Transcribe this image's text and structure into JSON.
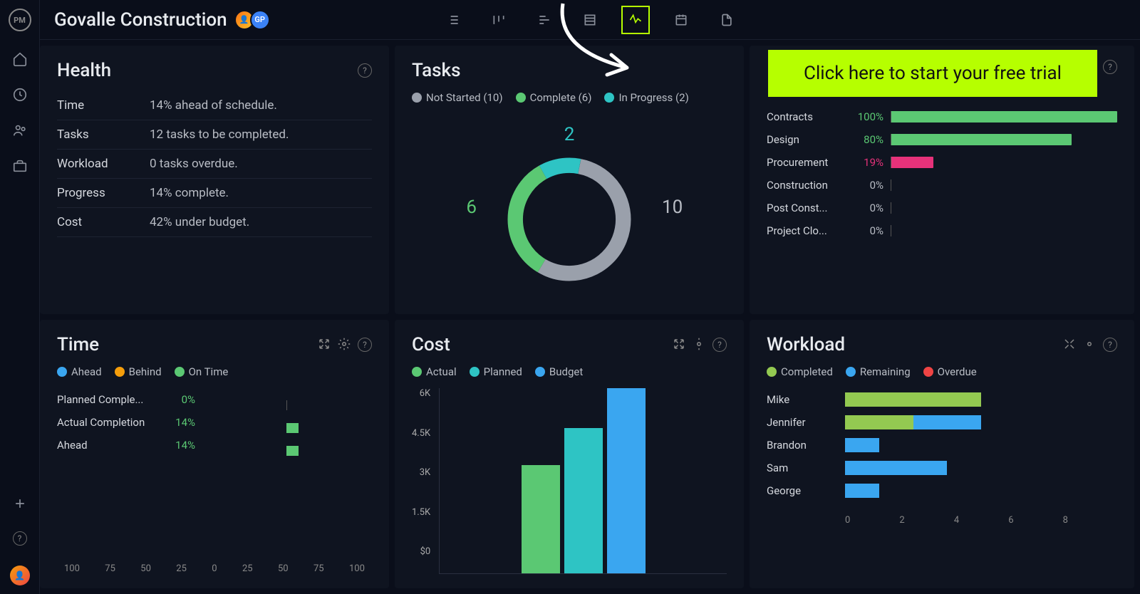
{
  "project_title": "Govalle Construction",
  "avatar_initials": "GP",
  "cta_text": "Click here to start your free trial",
  "colors": {
    "green": "#5bc873",
    "teal": "#2ec4c4",
    "gray": "#9aa0ab",
    "blue": "#3aa6f0",
    "pink": "#e6327a",
    "lime": "#93c951",
    "orange": "#f59e0b",
    "red": "#ef4444"
  },
  "health": {
    "title": "Health",
    "rows": [
      {
        "label": "Time",
        "value": "14% ahead of schedule."
      },
      {
        "label": "Tasks",
        "value": "12 tasks to be completed."
      },
      {
        "label": "Workload",
        "value": "0 tasks overdue."
      },
      {
        "label": "Progress",
        "value": "14% complete."
      },
      {
        "label": "Cost",
        "value": "42% under budget."
      }
    ]
  },
  "tasks": {
    "title": "Tasks",
    "legend": [
      {
        "label": "Not Started (10)",
        "color": "#9aa0ab"
      },
      {
        "label": "Complete (6)",
        "color": "#5bc873"
      },
      {
        "label": "In Progress (2)",
        "color": "#2ec4c4"
      }
    ],
    "top_label": "2",
    "left_label": "6",
    "right_label": "10"
  },
  "progress": {
    "rows": [
      {
        "name": "Contracts",
        "pct": 100,
        "color": "#5bc873"
      },
      {
        "name": "Design",
        "pct": 80,
        "color": "#5bc873"
      },
      {
        "name": "Procurement",
        "pct": 19,
        "color": "#e6327a"
      },
      {
        "name": "Construction",
        "pct": 0,
        "color": "#5bc873"
      },
      {
        "name": "Post Const...",
        "pct": 0,
        "color": "#5bc873"
      },
      {
        "name": "Project Clo...",
        "pct": 0,
        "color": "#5bc873"
      }
    ]
  },
  "time": {
    "title": "Time",
    "legend": [
      {
        "label": "Ahead",
        "color": "#3aa6f0"
      },
      {
        "label": "Behind",
        "color": "#f59e0b"
      },
      {
        "label": "On Time",
        "color": "#5bc873"
      }
    ],
    "rows": [
      {
        "name": "Planned Comple...",
        "pct": 0
      },
      {
        "name": "Actual Completion",
        "pct": 14
      },
      {
        "name": "Ahead",
        "pct": 14
      }
    ],
    "axis": [
      "100",
      "75",
      "50",
      "25",
      "0",
      "25",
      "50",
      "75",
      "100"
    ]
  },
  "cost": {
    "title": "Cost",
    "legend": [
      {
        "label": "Actual",
        "color": "#5bc873"
      },
      {
        "label": "Planned",
        "color": "#2ec4c4"
      },
      {
        "label": "Budget",
        "color": "#3aa6f0"
      }
    ],
    "yaxis": [
      "6K",
      "4.5K",
      "3K",
      "1.5K",
      "$0"
    ]
  },
  "workload": {
    "title": "Workload",
    "legend": [
      {
        "label": "Completed",
        "color": "#93c951"
      },
      {
        "label": "Remaining",
        "color": "#3aa6f0"
      },
      {
        "label": "Overdue",
        "color": "#ef4444"
      }
    ],
    "rows": [
      {
        "name": "Mike",
        "completed": 4,
        "remaining": 0
      },
      {
        "name": "Jennifer",
        "completed": 2,
        "remaining": 2
      },
      {
        "name": "Brandon",
        "completed": 0,
        "remaining": 1
      },
      {
        "name": "Sam",
        "completed": 0,
        "remaining": 3
      },
      {
        "name": "George",
        "completed": 0,
        "remaining": 1
      }
    ],
    "axis": [
      "0",
      "2",
      "4",
      "6",
      "8"
    ]
  },
  "chart_data": [
    {
      "type": "pie",
      "title": "Tasks",
      "categories": [
        "Not Started",
        "Complete",
        "In Progress"
      ],
      "values": [
        10,
        6,
        2
      ]
    },
    {
      "type": "bar",
      "title": "Progress by phase (%)",
      "categories": [
        "Contracts",
        "Design",
        "Procurement",
        "Construction",
        "Post Construction",
        "Project Closure"
      ],
      "values": [
        100,
        80,
        19,
        0,
        0,
        0
      ],
      "ylim": [
        0,
        100
      ]
    },
    {
      "type": "bar",
      "title": "Time",
      "categories": [
        "Planned Completion",
        "Actual Completion",
        "Ahead"
      ],
      "values": [
        0,
        14,
        14
      ],
      "xlabel": "",
      "ylabel": "%",
      "ylim": [
        -100,
        100
      ]
    },
    {
      "type": "bar",
      "title": "Cost",
      "categories": [
        "Actual",
        "Planned",
        "Budget"
      ],
      "values": [
        3500,
        4700,
        6000
      ],
      "ylabel": "$",
      "ylim": [
        0,
        6000
      ]
    },
    {
      "type": "bar",
      "title": "Workload",
      "categories": [
        "Mike",
        "Jennifer",
        "Brandon",
        "Sam",
        "George"
      ],
      "series": [
        {
          "name": "Completed",
          "values": [
            4,
            2,
            0,
            0,
            0
          ]
        },
        {
          "name": "Remaining",
          "values": [
            0,
            2,
            1,
            3,
            1
          ]
        },
        {
          "name": "Overdue",
          "values": [
            0,
            0,
            0,
            0,
            0
          ]
        }
      ],
      "ylim": [
        0,
        8
      ]
    }
  ]
}
